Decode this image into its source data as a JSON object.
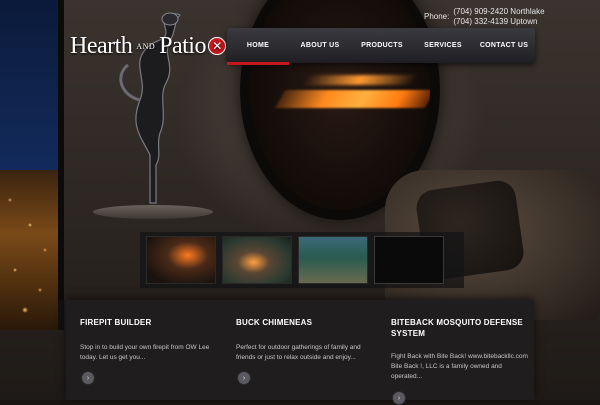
{
  "logo": {
    "part1": "Hearth",
    "and": "AND",
    "part2": "Patio",
    "mark_icon": "flame-circle-icon"
  },
  "contact": {
    "label": "Phone:",
    "lines": [
      "(704) 909-2420 Northlake",
      "(704) 332-4139 Uptown"
    ]
  },
  "nav": {
    "items": [
      {
        "label": "HOME",
        "active": true
      },
      {
        "label": "ABOUT US",
        "active": false
      },
      {
        "label": "PRODUCTS",
        "active": false
      },
      {
        "label": "SERVICES",
        "active": false
      },
      {
        "label": "CONTACT US",
        "active": false
      }
    ]
  },
  "features": [
    {
      "title": "FIREPIT BUILDER",
      "body": "Stop in to build your own firepit from OW Lee today. Let us get you...",
      "more_icon": "chevron-right-icon"
    },
    {
      "title": "BUCK CHIMENEAS",
      "body": "Perfect for outdoor gatherings of family and friends or just to relax outside and enjoy...",
      "more_icon": "chevron-right-icon"
    },
    {
      "title": "BITEBACK MOSQUITO DEFENSE SYSTEM",
      "body": "Fight Back with Bite Back! www.bitebackllc.com Bite Back !, LLC is a family owned and operated...",
      "more_icon": "chevron-right-icon"
    }
  ],
  "colors": {
    "accent": "#c4161c",
    "nav_bg": "#2b2b30",
    "panel_bg": "#201d1f"
  }
}
